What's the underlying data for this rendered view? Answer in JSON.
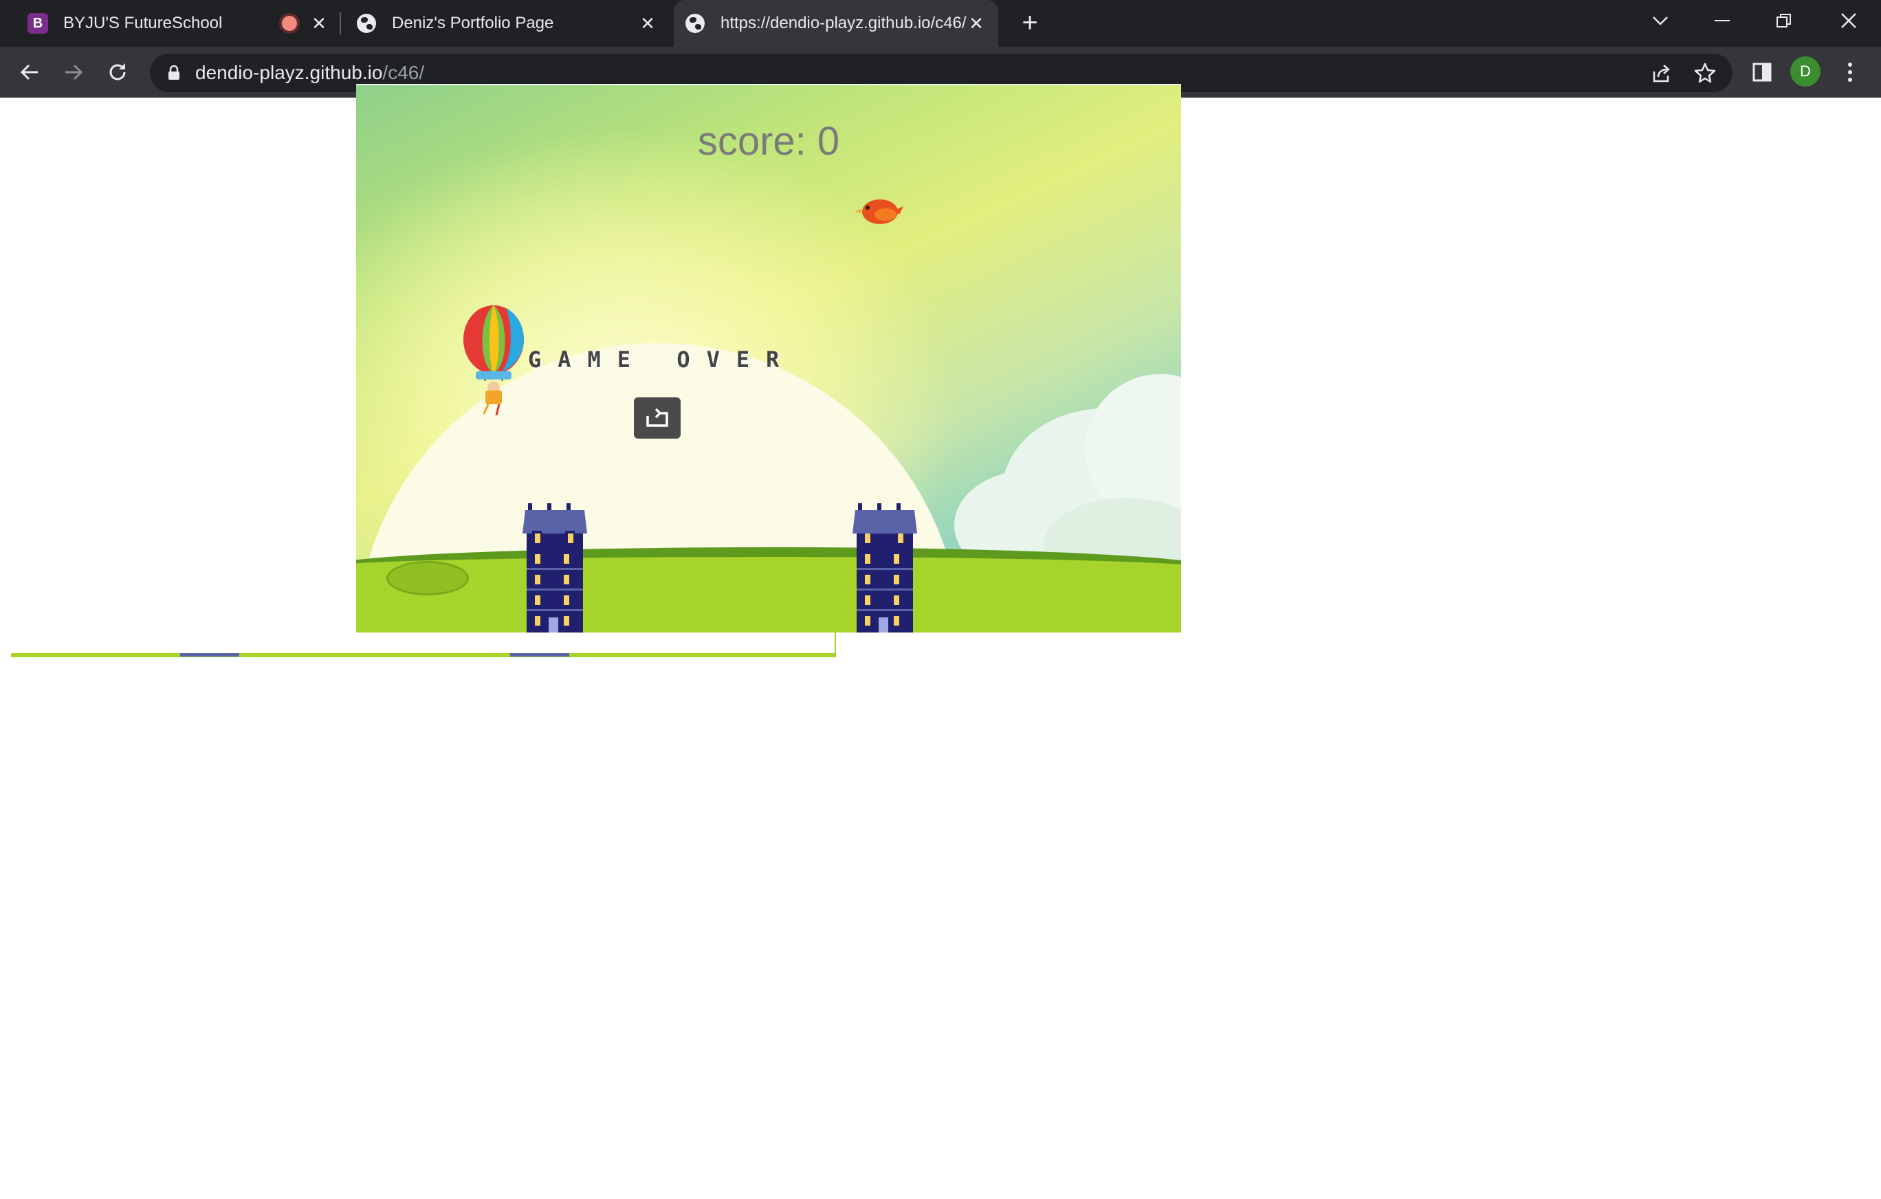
{
  "browser": {
    "tabs": [
      {
        "title": "BYJU'S FutureSchool",
        "favicon": "byjus-icon",
        "recording": true,
        "active": false
      },
      {
        "title": "Deniz's Portfolio Page",
        "favicon": "globe-icon",
        "active": false
      },
      {
        "title": "https://dendio-playz.github.io/c46/",
        "favicon": "globe-icon",
        "active": true
      }
    ],
    "url_host": "dendio-playz.github.io",
    "url_path": "/c46/",
    "profile_initial": "D",
    "colors": {
      "frame": "#202124",
      "toolbar": "#35363a",
      "text": "#e8eaed",
      "profile": "#3c8d2f"
    }
  },
  "game": {
    "score_text": "score: 0",
    "game_over_text": "GAME OVER",
    "restart_icon": "restart-icon",
    "colors": {
      "ground": "#a6d42a",
      "building": "#20206e",
      "bird": "#e8501e"
    }
  }
}
